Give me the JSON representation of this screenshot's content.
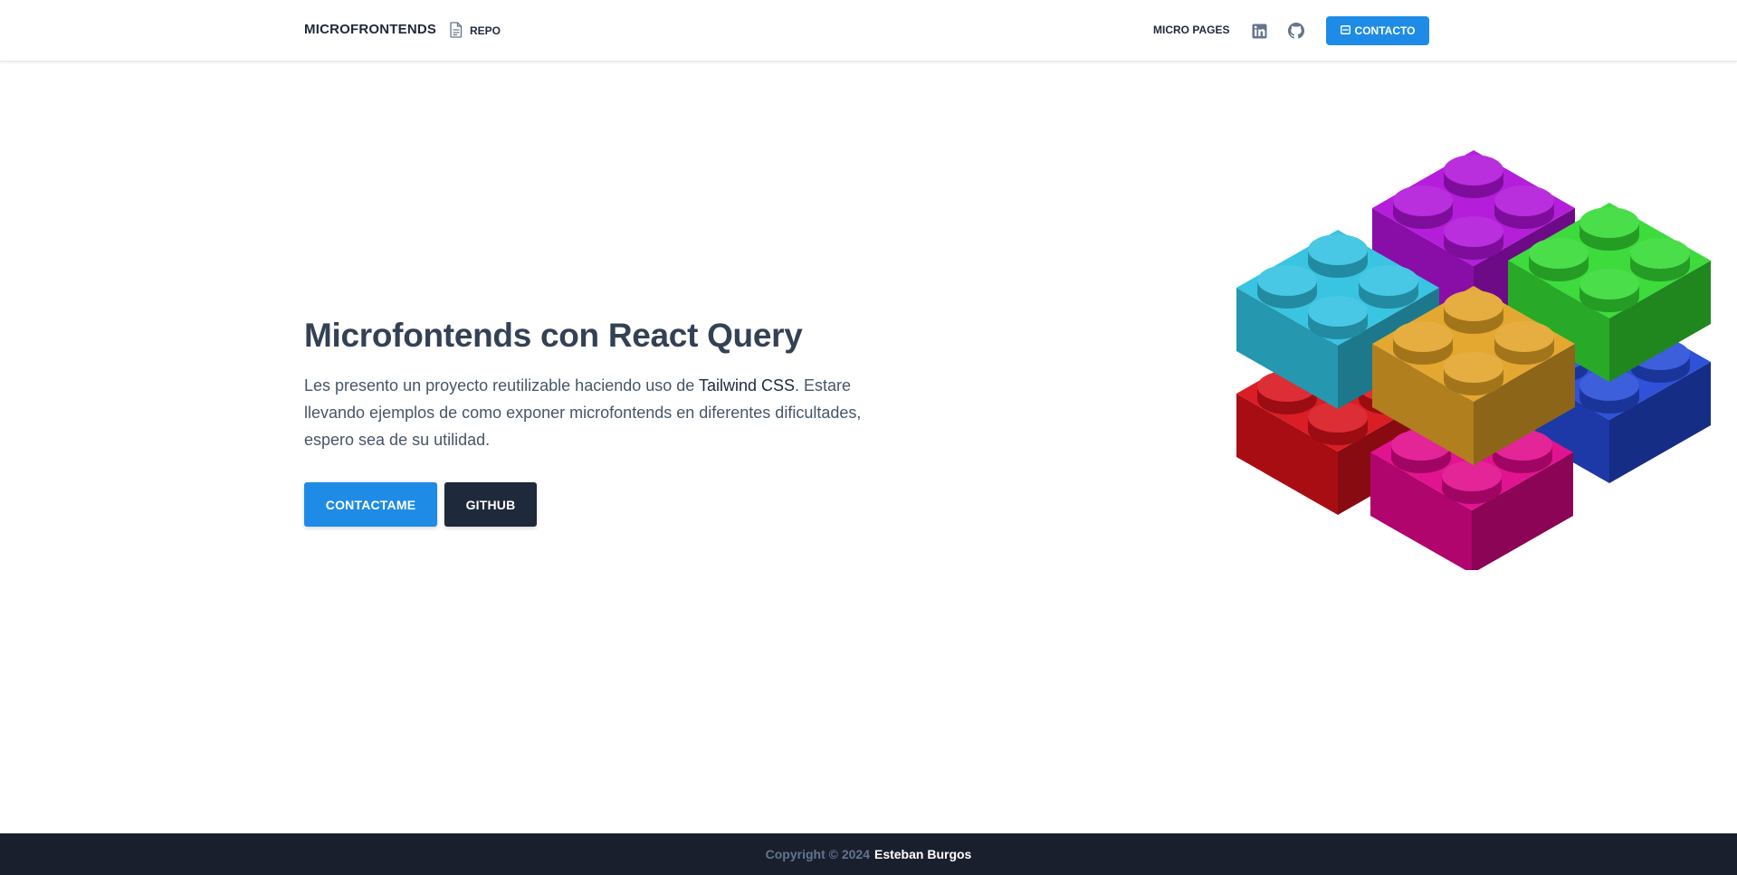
{
  "navbar": {
    "brand": "MICROFRONTENDS",
    "repo_label": "REPO",
    "micro_pages_label": "MICRO PAGES",
    "contact_label": "CONTACTO"
  },
  "hero": {
    "title": "Microfontends con React Query",
    "text_before": "Les presento un proyecto reutilizable haciendo uso de ",
    "text_highlight": "Tailwind CSS",
    "text_after": ". Estare llevando ejemplos de como exponer microfontends en diferentes dificultades, espero sea de su utilidad.",
    "primary_button": "CONTACTAME",
    "secondary_button": "GITHUB"
  },
  "footer": {
    "copyright": "Copyright © 2024",
    "author": "Esteban Burgos"
  },
  "colors": {
    "accent": "#1e8ce6",
    "dark": "#1e293b",
    "footer_bg": "#1a1f2e",
    "brick_purple": "#b012d8",
    "brick_cyan": "#2fc1e0",
    "brick_green": "#33d932",
    "brick_yellow": "#e3a326",
    "brick_red": "#d9111a",
    "brick_pink": "#e0078a",
    "brick_blue": "#2449d6"
  },
  "icons": {
    "repo": "document-icon",
    "linkedin": "linkedin-icon",
    "github": "github-icon",
    "contact": "mail-icon"
  }
}
